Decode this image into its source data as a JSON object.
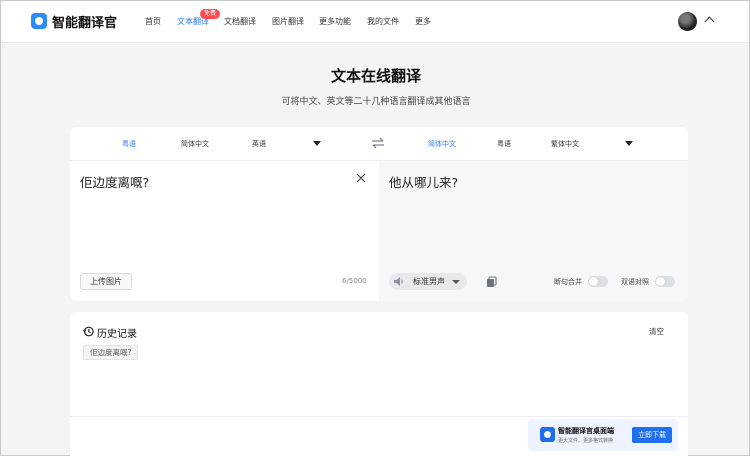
{
  "brand": {
    "name": "智能翻译官",
    "accent": "#2a7cf6"
  },
  "nav": {
    "items": [
      {
        "label": "首页"
      },
      {
        "label": "文本翻译"
      },
      {
        "label": "文档翻译"
      },
      {
        "label": "图片翻译"
      },
      {
        "label": "更多功能"
      },
      {
        "label": "我的文件"
      },
      {
        "label": "更多"
      }
    ],
    "badge": "免费",
    "active_index": 1
  },
  "page": {
    "title": "文本在线翻译",
    "subtitle": "可将中文、英文等二十几种语言翻译成其他语言"
  },
  "source_langs": [
    "粤语",
    "简体中文",
    "英语"
  ],
  "target_langs": [
    "简体中文",
    "粤语",
    "繁体中文"
  ],
  "source": {
    "text": "佢边度离嘅?",
    "counter": "6/5000",
    "upload_label": "上传图片"
  },
  "target": {
    "text": "他从哪儿来?",
    "voice_label": "标准男声",
    "toggle_merge": "断句合并",
    "toggle_bilingual": "双语对照"
  },
  "history": {
    "title": "历史记录",
    "clear_label": "清空",
    "items": [
      "佢边度离嘅?"
    ]
  },
  "promo": {
    "title": "智能翻译官桌面端",
    "subtitle": "更大文件、更多格式转换",
    "button": "立即下载"
  },
  "icons": {
    "logo": "translator-logo-icon",
    "swap": "swap-arrows-icon",
    "clear": "close-icon",
    "speaker": "speaker-icon",
    "copy": "copy-icon",
    "history": "clock-history-icon",
    "chevron": "chevron-up-icon"
  }
}
